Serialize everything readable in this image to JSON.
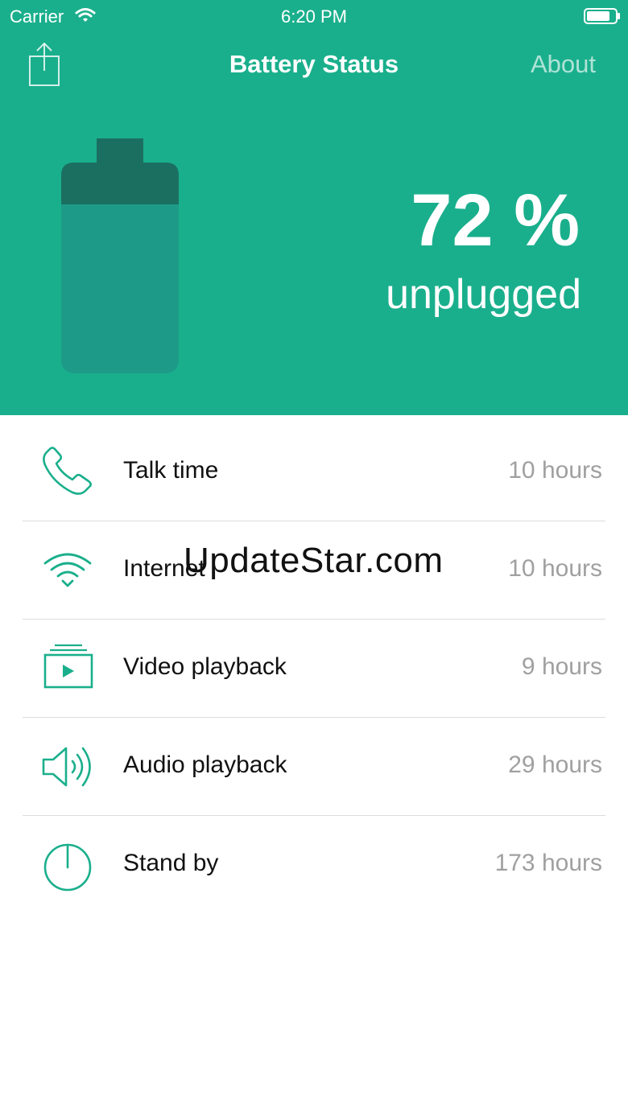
{
  "status_bar": {
    "carrier": "Carrier",
    "time": "6:20 PM"
  },
  "nav": {
    "title": "Battery Status",
    "about_label": "About"
  },
  "battery": {
    "level_percent": 72,
    "percent_text": "72 %",
    "state": "unplugged"
  },
  "colors": {
    "header_bg": "#1aaf8c",
    "accent": "#1aaf8c",
    "battery_top": "#1b6f61",
    "battery_body": "#1d9b88"
  },
  "usage": [
    {
      "icon": "phone-icon",
      "label": "Talk time",
      "value": "10 hours"
    },
    {
      "icon": "wifi-icon",
      "label": "Internet",
      "value": "10 hours"
    },
    {
      "icon": "video-icon",
      "label": "Video playback",
      "value": "9 hours"
    },
    {
      "icon": "speaker-icon",
      "label": "Audio playback",
      "value": "29 hours"
    },
    {
      "icon": "power-icon",
      "label": "Stand by",
      "value": "173 hours"
    }
  ],
  "watermark": "UpdateStar.com"
}
